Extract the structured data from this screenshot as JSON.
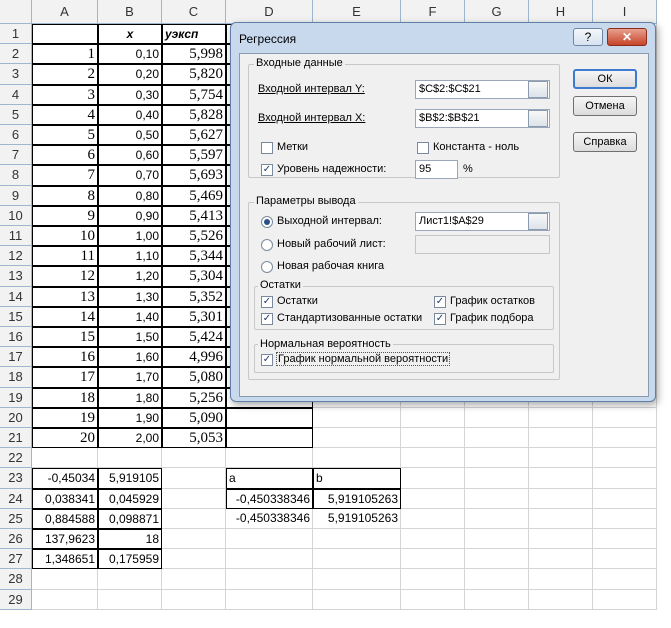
{
  "sheet": {
    "columns": [
      "A",
      "B",
      "C",
      "D",
      "E",
      "F",
      "G",
      "H",
      "I"
    ],
    "rows": [
      {
        "n": "1",
        "a": "",
        "b": "x",
        "c": "уэксп"
      },
      {
        "n": "2",
        "a": "1",
        "b": "0,10",
        "c": "5,998"
      },
      {
        "n": "3",
        "a": "2",
        "b": "0,20",
        "c": "5,820"
      },
      {
        "n": "4",
        "a": "3",
        "b": "0,30",
        "c": "5,754"
      },
      {
        "n": "5",
        "a": "4",
        "b": "0,40",
        "c": "5,828"
      },
      {
        "n": "6",
        "a": "5",
        "b": "0,50",
        "c": "5,627"
      },
      {
        "n": "7",
        "a": "6",
        "b": "0,60",
        "c": "5,597"
      },
      {
        "n": "8",
        "a": "7",
        "b": "0,70",
        "c": "5,693"
      },
      {
        "n": "9",
        "a": "8",
        "b": "0,80",
        "c": "5,469"
      },
      {
        "n": "10",
        "a": "9",
        "b": "0,90",
        "c": "5,413"
      },
      {
        "n": "11",
        "a": "10",
        "b": "1,00",
        "c": "5,526"
      },
      {
        "n": "12",
        "a": "11",
        "b": "1,10",
        "c": "5,344"
      },
      {
        "n": "13",
        "a": "12",
        "b": "1,20",
        "c": "5,304"
      },
      {
        "n": "14",
        "a": "13",
        "b": "1,30",
        "c": "5,352"
      },
      {
        "n": "15",
        "a": "14",
        "b": "1,40",
        "c": "5,301"
      },
      {
        "n": "16",
        "a": "15",
        "b": "1,50",
        "c": "5,424"
      },
      {
        "n": "17",
        "a": "16",
        "b": "1,60",
        "c": "4,996"
      },
      {
        "n": "18",
        "a": "17",
        "b": "1,70",
        "c": "5,080"
      },
      {
        "n": "19",
        "a": "18",
        "b": "1,80",
        "c": "5,256"
      },
      {
        "n": "20",
        "a": "19",
        "b": "1,90",
        "c": "5,090"
      },
      {
        "n": "21",
        "a": "20",
        "b": "2,00",
        "c": "5,053"
      },
      {
        "n": "22",
        "a": "",
        "b": "",
        "c": ""
      },
      {
        "n": "23",
        "a": "-0,45034",
        "b": "5,919105",
        "c": "",
        "d": "a",
        "e": "b"
      },
      {
        "n": "24",
        "a": "0,038341",
        "b": "0,045929",
        "c": "",
        "d": "-0,450338346",
        "e": "5,919105263"
      },
      {
        "n": "25",
        "a": "0,884588",
        "b": "0,098871",
        "c": "",
        "d": "-0,450338346",
        "e": "5,919105263"
      },
      {
        "n": "26",
        "a": "137,9623",
        "b": "18",
        "c": ""
      },
      {
        "n": "27",
        "a": "1,348651",
        "b": "0,175959",
        "c": ""
      },
      {
        "n": "28",
        "a": "",
        "b": "",
        "c": ""
      },
      {
        "n": "29",
        "a": "",
        "b": "",
        "c": ""
      }
    ]
  },
  "dialog": {
    "title": "Регрессия",
    "help_glyph": "?",
    "close_glyph": "✕",
    "input_group": {
      "label": "Входные данные",
      "y_label": "Входной интервал Y:",
      "y_value": "$C$2:$C$21",
      "x_label": "Входной интервал X:",
      "x_value": "$B$2:$B$21",
      "labels_cb": "Метки",
      "labels_checked": false,
      "const_cb": "Константа - ноль",
      "const_checked": false,
      "conf_cb": "Уровень надежности:",
      "conf_checked": true,
      "conf_value": "95",
      "conf_unit": "%"
    },
    "output_group": {
      "label": "Параметры вывода",
      "range_label": "Выходной интервал:",
      "range_value": "Лист1!$A$29",
      "new_sheet": "Новый рабочий лист:",
      "new_book": "Новая рабочая книга",
      "selected": "range"
    },
    "residuals_group": {
      "label": "Остатки",
      "residuals": "Остатки",
      "std_residuals": "Стандартизованные остатки",
      "residual_plot": "График остатков",
      "fit_plot": "График подбора",
      "checked": [
        true,
        true,
        true,
        true
      ]
    },
    "normal_group": {
      "label": "Нормальная вероятность",
      "normal_plot": "График нормальной вероятности",
      "checked": true
    },
    "buttons": {
      "ok": "ОК",
      "cancel": "Отмена",
      "help": "Справка"
    },
    "check_glyph": "✓"
  }
}
